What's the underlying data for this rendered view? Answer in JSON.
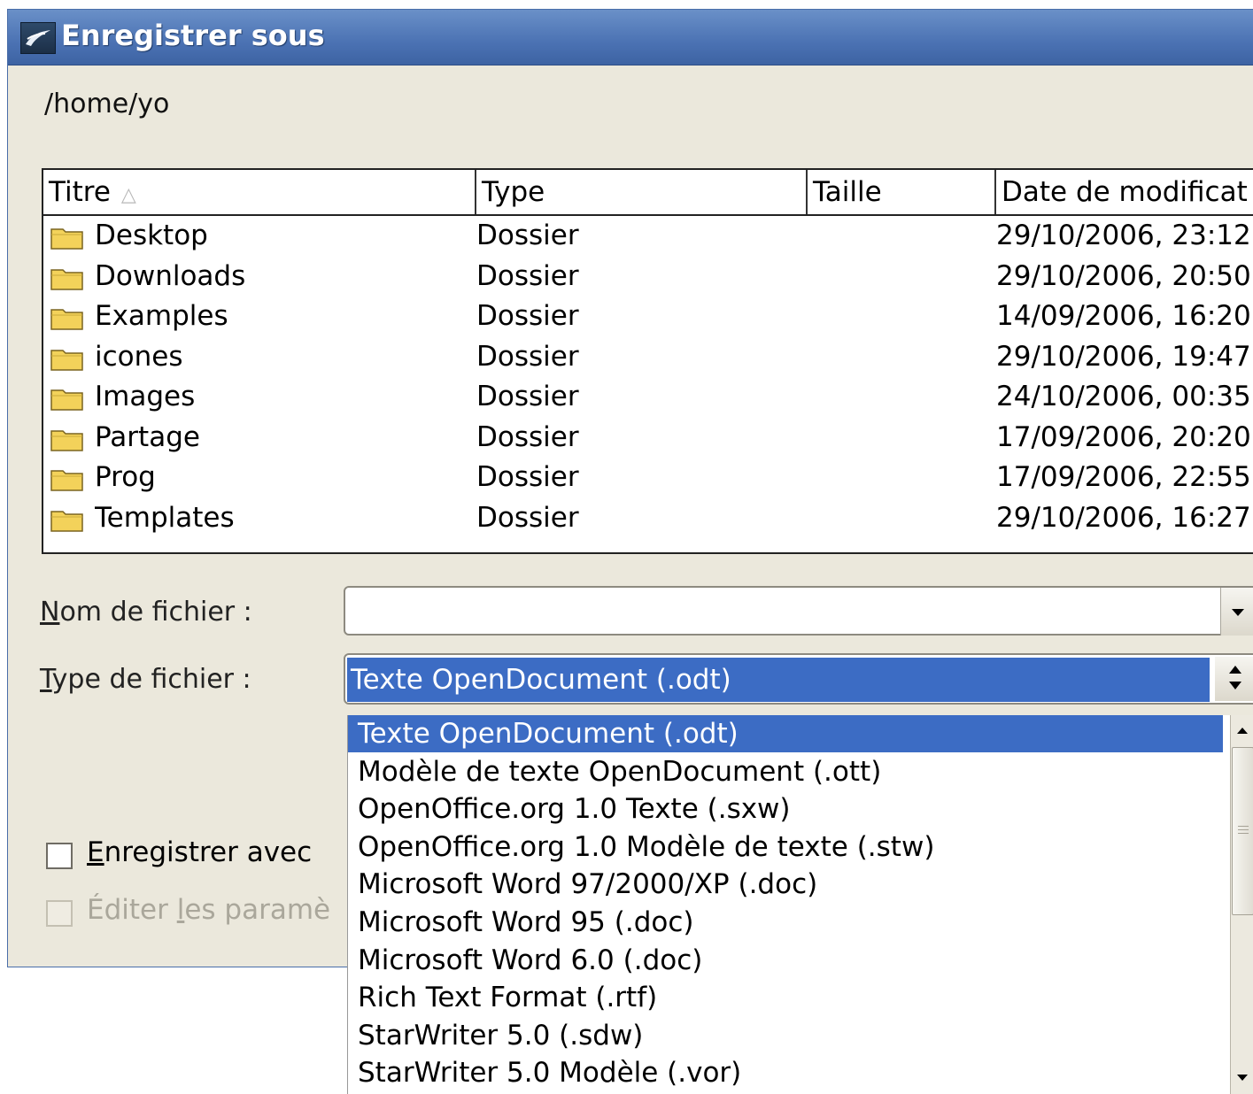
{
  "window": {
    "title": "Enregistrer sous"
  },
  "path": "/home/yo",
  "filelist": {
    "columns": [
      "Titre",
      "Type",
      "Taille",
      "Date de modificat"
    ],
    "sort_indicator": "△",
    "rows": [
      {
        "name": "Desktop",
        "type": "Dossier",
        "size": "",
        "date": "29/10/2006, 23:12"
      },
      {
        "name": "Downloads",
        "type": "Dossier",
        "size": "",
        "date": "29/10/2006, 20:50"
      },
      {
        "name": "Examples",
        "type": "Dossier",
        "size": "",
        "date": "14/09/2006, 16:20"
      },
      {
        "name": "icones",
        "type": "Dossier",
        "size": "",
        "date": "29/10/2006, 19:47"
      },
      {
        "name": "Images",
        "type": "Dossier",
        "size": "",
        "date": "24/10/2006, 00:35"
      },
      {
        "name": "Partage",
        "type": "Dossier",
        "size": "",
        "date": "17/09/2006, 20:20"
      },
      {
        "name": "Prog",
        "type": "Dossier",
        "size": "",
        "date": "17/09/2006, 22:55"
      },
      {
        "name": "Templates",
        "type": "Dossier",
        "size": "",
        "date": "29/10/2006, 16:27"
      }
    ]
  },
  "form": {
    "filename_label": "Nom de fichier :",
    "filename_value": "",
    "filetype_label": "Type de fichier :",
    "filetype_value": "Texte OpenDocument (.odt)"
  },
  "checkboxes": [
    {
      "label": "Enregistrer avec",
      "checked": false,
      "enabled": true
    },
    {
      "label": "Éditer les paramè",
      "checked": false,
      "enabled": false
    }
  ],
  "dropdown": {
    "selected_index": 0,
    "items": [
      "Texte OpenDocument (.odt)",
      "Modèle de texte OpenDocument (.ott)",
      "OpenOffice.org 1.0 Texte (.sxw)",
      "OpenOffice.org 1.0 Modèle de texte (.stw)",
      "Microsoft Word 97/2000/XP (.doc)",
      "Microsoft Word 95 (.doc)",
      "Microsoft Word 6.0 (.doc)",
      "Rich Text Format (.rtf)",
      "StarWriter 5.0 (.sdw)",
      "StarWriter 5.0 Modèle (.vor)"
    ]
  },
  "colors": {
    "titlebar": "#4b72b3",
    "dialog_bg": "#ebe8dc",
    "selection": "#3c6cc4",
    "folder": "#f3d25a"
  },
  "icons": {
    "app": "openoffice-icon",
    "folder": "folder-icon",
    "sort": "sort-ascending-icon",
    "combo": "chevron-down-icon"
  }
}
